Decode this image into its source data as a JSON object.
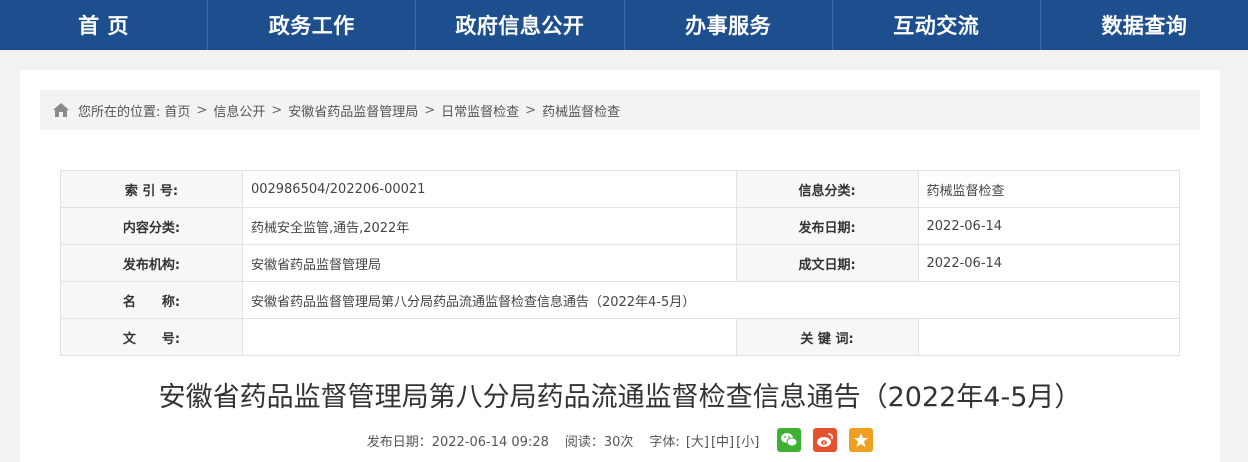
{
  "nav": {
    "items": [
      {
        "label": "首 页"
      },
      {
        "label": "政务工作"
      },
      {
        "label": "政府信息公开"
      },
      {
        "label": "办事服务"
      },
      {
        "label": "互动交流"
      },
      {
        "label": "数据查询"
      }
    ]
  },
  "breadcrumb": {
    "prefix": "您所在的位置:",
    "items": [
      "首页",
      "信息公开",
      "安徽省药品监督管理局",
      "日常监督检查",
      "药械监督检查"
    ],
    "separator": ">"
  },
  "meta": {
    "index_label": "索 引 号:",
    "index_value": "002986504/202206-00021",
    "category_label": "信息分类:",
    "category_value": "药械监督检查",
    "content_label": "内容分类:",
    "content_value": "药械安全监管,通告,2022年",
    "publish_date_label": "发布日期:",
    "publish_date_value": "2022-06-14",
    "agency_label": "发布机构:",
    "agency_value": "安徽省药品监督管理局",
    "created_date_label": "成文日期:",
    "created_date_value": "2022-06-14",
    "name_label": "名　　称:",
    "name_value": "安徽省药品监督管理局第八分局药品流通监督检查信息通告（2022年4-5月）",
    "doc_no_label": "文　　号:",
    "doc_no_value": "",
    "keywords_label": "关 键 词:",
    "keywords_value": ""
  },
  "article": {
    "title": "安徽省药品监督管理局第八分局药品流通监督检查信息通告（2022年4-5月）",
    "publish_info": "发布日期：2022-06-14 09:28",
    "reads": "阅读：30次",
    "font_label": "字体:",
    "font_large": "[大]",
    "font_medium": "[中]",
    "font_small": "[小]"
  },
  "share": {
    "icons": [
      "wechat-icon",
      "weibo-icon",
      "favorite-icon"
    ],
    "colors": {
      "wechat": "#3eb135",
      "weibo": "#e6522c",
      "favorite": "#f0a020"
    }
  },
  "colors": {
    "nav_bg": "#1d4f8f"
  }
}
